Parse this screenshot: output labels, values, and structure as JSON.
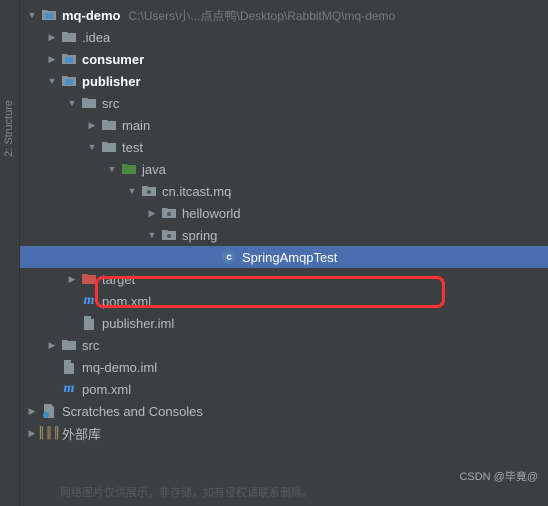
{
  "gutter": "2: Structure",
  "root": {
    "name": "mq-demo",
    "hint": "C:\\Users\\小...点点鸭\\Desktop\\RabbitMQ\\mq-demo"
  },
  "idea": ".idea",
  "consumer": "consumer",
  "publisher": "publisher",
  "src": "src",
  "main": "main",
  "test": "test",
  "java": "java",
  "pkg": "cn.itcast.mq",
  "helloworld": "helloworld",
  "spring": "spring",
  "springAmqpTest": "SpringAmqpTest",
  "target": "target",
  "pom": "pom.xml",
  "publisherIml": "publisher.iml",
  "src2": "src",
  "mqDemoIml": "mq-demo.iml",
  "pom2": "pom.xml",
  "scratches": "Scratches and Consoles",
  "externalLibs": "外部库",
  "watermark": "CSDN @毕竟@",
  "watermark2": "网络图片仅供展示，非存储，如有侵权请联系删除。"
}
